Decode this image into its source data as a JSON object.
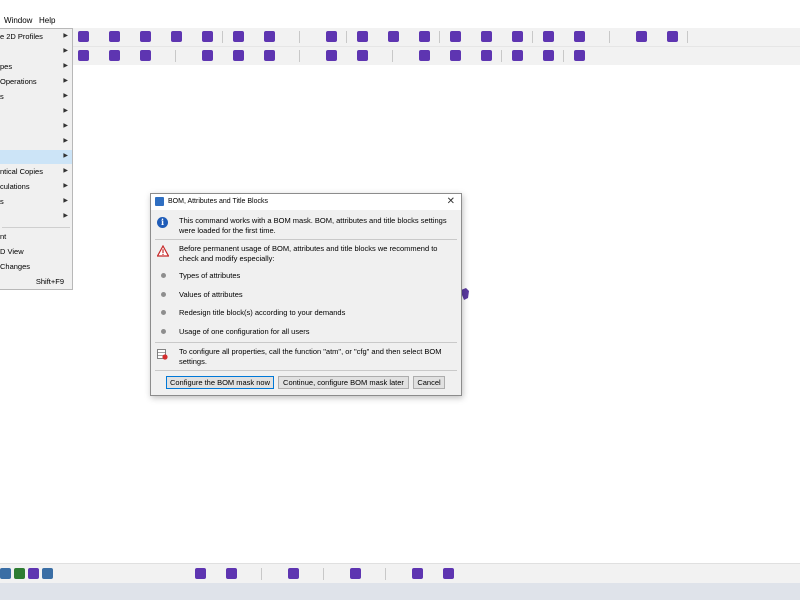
{
  "menubar": {
    "window": "Window",
    "help": "Help"
  },
  "left_menu": {
    "items": [
      {
        "label": "e 2D Profiles",
        "submenu": true
      },
      {
        "label": "",
        "submenu": true
      },
      {
        "label": "pes",
        "submenu": true
      },
      {
        "label": "Operations",
        "submenu": true
      },
      {
        "label": "s",
        "submenu": true
      },
      {
        "label": "",
        "submenu": true
      },
      {
        "label": "",
        "submenu": true
      },
      {
        "label": "",
        "submenu": true
      },
      {
        "label": "",
        "submenu": true
      },
      {
        "label": "ntical Copies",
        "submenu": true
      },
      {
        "label": "culations",
        "submenu": true
      },
      {
        "label": "s",
        "submenu": true
      },
      {
        "label": "",
        "submenu": true
      }
    ],
    "extra_items": [
      {
        "label": "nt"
      },
      {
        "label": "D View"
      },
      {
        "label": "Changes"
      }
    ],
    "shortcut": "Shift+F9"
  },
  "dialog": {
    "title": "BOM, Attributes and Title Blocks",
    "close_glyph": "✕",
    "info_glyph": "i",
    "info_text": "This command works with a BOM mask. BOM, attributes and title blocks settings were loaded for the first time.",
    "warning_text": "Before permanent usage of BOM, attributes and title blocks we recommend to check and modify especially:",
    "bullets": [
      "Types of attributes",
      "Values of attributes",
      "Redesign title block(s) according to your demands",
      "Usage of one configuration for all users"
    ],
    "config_text": "To configure all properties, call the function \"atm\", or \"cfg\" and then select BOM settings.",
    "buttons": {
      "configure_now": "Configure the BOM mask now",
      "configure_later": "Continue, configure BOM mask later",
      "cancel": "Cancel"
    }
  },
  "colors": {
    "accent": "#0078d7",
    "info_blue": "#1f5cb8",
    "warning_red": "#c62828",
    "menu_highlight": "#cce4f7",
    "cad_purple": "#5b3aa0"
  }
}
